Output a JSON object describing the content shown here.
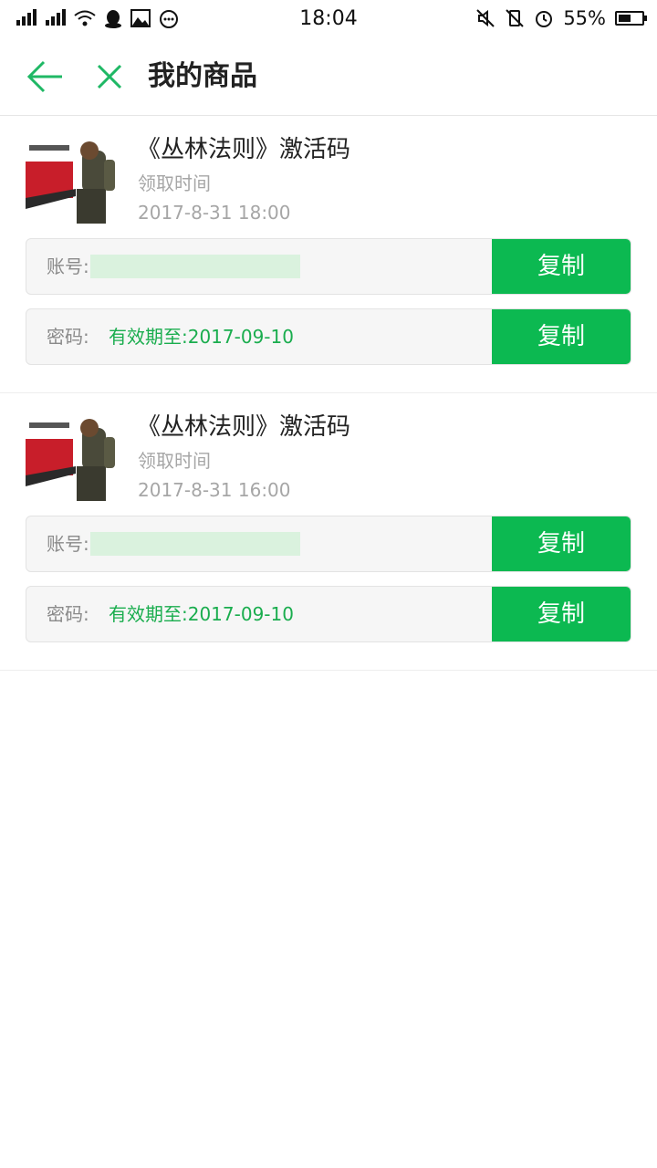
{
  "status_bar": {
    "time": "18:04",
    "battery_percent": "55%",
    "battery_level": 0.55,
    "icons_left": [
      "signal-icon",
      "signal-icon",
      "wifi-icon",
      "qq-icon",
      "image-icon",
      "more-icon"
    ],
    "icons_right": [
      "mute-icon",
      "vibrate-off-icon",
      "alarm-icon",
      "battery-icon"
    ]
  },
  "app_bar": {
    "title": "我的商品",
    "back_icon": "arrow-left-icon",
    "close_icon": "close-icon",
    "accent_color": "#1fb865"
  },
  "items": [
    {
      "name": "《丛林法则》激活码",
      "claim_label": "领取时间",
      "claim_time": "2017-8-31 18:00",
      "account_label": "账号:",
      "account_value": "",
      "password_label": "密码:",
      "password_value": "有效期至:2017-09-10",
      "copy_label": "复制"
    },
    {
      "name": "《丛林法则》激活码",
      "claim_label": "领取时间",
      "claim_time": "2017-8-31 16:00",
      "account_label": "账号:",
      "account_value": "",
      "password_label": "密码:",
      "password_value": "有效期至:2017-09-10",
      "copy_label": "复制"
    }
  ],
  "colors": {
    "button_green": "#0cb951",
    "value_green": "#1aad4e",
    "muted_text": "#a6a6a6"
  }
}
